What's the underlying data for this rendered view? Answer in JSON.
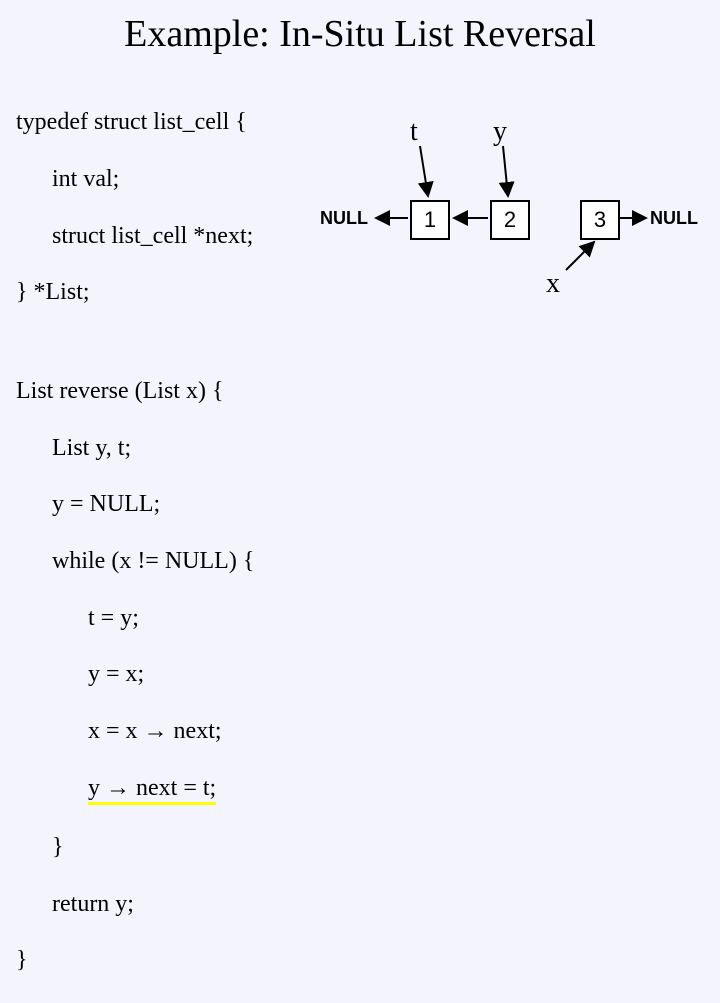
{
  "title": "Example: In-Situ List Reversal",
  "typedef": {
    "l1": "typedef struct list_cell {",
    "l2": "int val;",
    "l3": "struct list_cell *next;",
    "l4": "} *List;"
  },
  "func": {
    "l1": "List reverse (List x) {",
    "l2": "List y, t;",
    "l3": "y = NULL;",
    "l4": "while (x != NULL) {",
    "l5": "t = y;",
    "l6": "y = x;",
    "l7a": "x = x ",
    "l7b": " next;",
    "l8a": "y ",
    "l8b": " next = t;",
    "l9": "}",
    "l10": "return y;",
    "l11": "}"
  },
  "arrow_glyph": "→",
  "diagram": {
    "ptr_t": "t",
    "ptr_y": "y",
    "ptr_x": "x",
    "null_left": "NULL",
    "null_right": "NULL",
    "node1": "1",
    "node2": "2",
    "node3": "3"
  }
}
